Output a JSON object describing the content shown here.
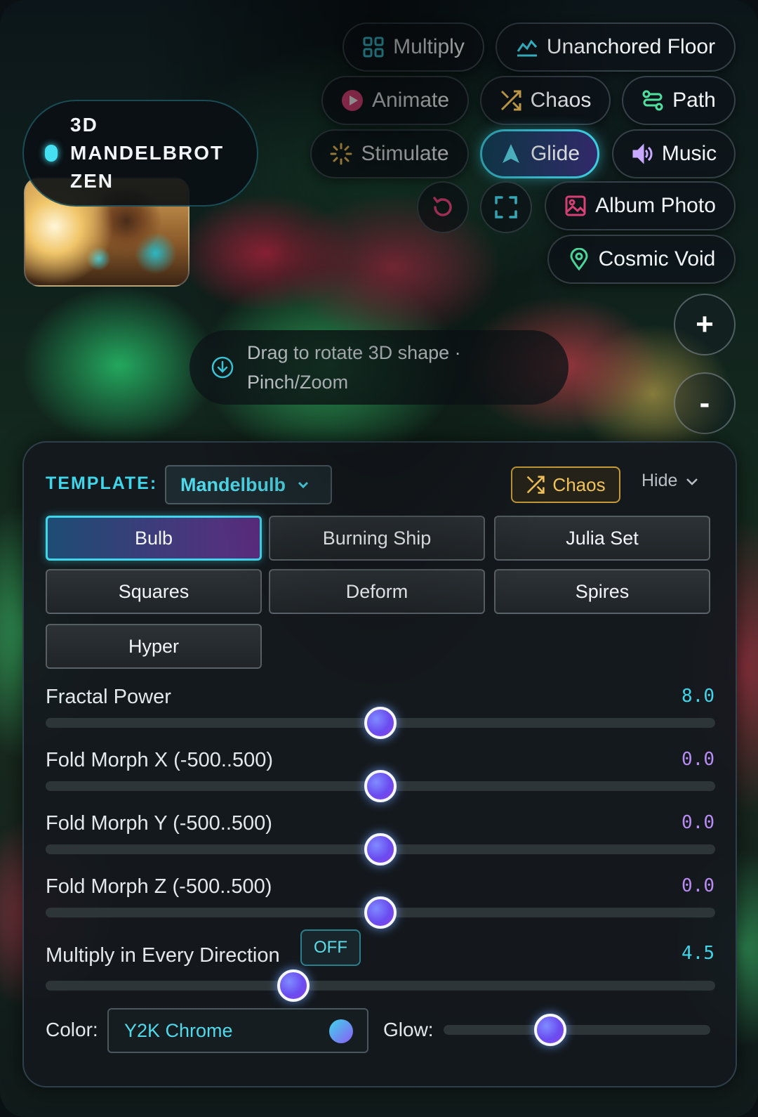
{
  "app": {
    "title": "3D MANDELBROT ZEN"
  },
  "toolbar": {
    "multiply": "Multiply",
    "unanchored_floor": "Unanchored Floor",
    "animate": "Animate",
    "chaos": "Chaos",
    "path": "Path",
    "stimulate": "Stimulate",
    "glide": "Glide",
    "music": "Music",
    "album_photo": "Album Photo",
    "cosmic_void": "Cosmic Void",
    "active": "Glide"
  },
  "zoom": {
    "in": "+",
    "out": "-"
  },
  "hint": {
    "text": "Drag to rotate 3D shape · Pinch/Zoom"
  },
  "panel": {
    "template_label": "TEMPLATE:",
    "template_value": "Mandelbulb",
    "chaos_label": "Chaos",
    "hide_label": "Hide",
    "templates": [
      "Bulb",
      "Burning Ship",
      "Julia Set",
      "Squares",
      "Deform",
      "Spires",
      "Hyper"
    ],
    "active_template": "Bulb",
    "sliders": [
      {
        "label": "Fractal Power",
        "value": "8.0",
        "value_color": "#3fd6ea",
        "fraction": 0.5
      },
      {
        "label": "Fold Morph X (-500..500)",
        "value": "0.0",
        "value_color": "#b98cf5",
        "fraction": 0.5
      },
      {
        "label": "Fold Morph Y (-500..500)",
        "value": "0.0",
        "value_color": "#b98cf5",
        "fraction": 0.5
      },
      {
        "label": "Fold Morph Z (-500..500)",
        "value": "0.0",
        "value_color": "#b98cf5",
        "fraction": 0.5
      },
      {
        "label": "Multiply in Every Direction",
        "value": "4.5",
        "value_color": "#3fd6ea",
        "fraction": 0.37,
        "toggle": "OFF"
      }
    ],
    "color_label": "Color:",
    "color_value": "Y2K Chrome",
    "glow_label": "Glow:",
    "glow_fraction": 0.4
  },
  "colors": {
    "accent": "#3fd6ea",
    "purple": "#8b5cf6",
    "chaos_gold": "#f2c25a"
  }
}
